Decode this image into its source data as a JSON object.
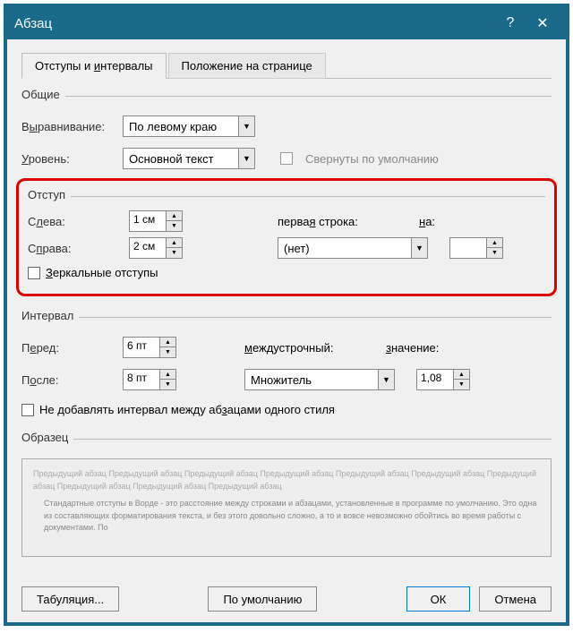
{
  "title": "Абзац",
  "tabs": {
    "indents": "Отступы и интервалы",
    "position": "Положение на странице"
  },
  "general": {
    "title": "Общие",
    "alignment_label": "Выравнивание:",
    "alignment_value": "По левому краю",
    "level_label": "Уровень:",
    "level_value": "Основной текст",
    "collapsed_label": "Свернуты по умолчанию"
  },
  "indent": {
    "title": "Отступ",
    "left_label": "Слева:",
    "left_value": "1 см",
    "right_label": "Справа:",
    "right_value": "2 см",
    "firstline_label": "первая строка:",
    "firstline_value": "(нет)",
    "by_label": "на:",
    "by_value": "",
    "mirror_label": "Зеркальные отступы"
  },
  "spacing": {
    "title": "Интервал",
    "before_label": "Перед:",
    "before_value": "6 пт",
    "after_label": "После:",
    "after_value": "8 пт",
    "line_label": "междустрочный:",
    "line_value": "Множитель",
    "at_label": "значение:",
    "at_value": "1,08",
    "dontadd_label": "Не добавлять интервал между абзацами одного стиля"
  },
  "preview": {
    "title": "Образец",
    "line1": "Предыдущий абзац Предыдущий абзац Предыдущий абзац Предыдущий абзац Предыдущий абзац Предыдущий абзац Предыдущий абзац Предыдущий абзац Предыдущий абзац Предыдущий абзац",
    "line2": "Стандартные отступы в Ворде - это расстояние между строками и абзацами, установленные в программе по умолчанию. Это одна из составляющих форматирования текста, и без этого довольно сложно, а то и вовсе невозможно обойтись во время работы с документами. По"
  },
  "footer": {
    "tabs_btn": "Табуляция...",
    "default_btn": "По умолчанию",
    "ok_btn": "ОК",
    "cancel_btn": "Отмена"
  }
}
